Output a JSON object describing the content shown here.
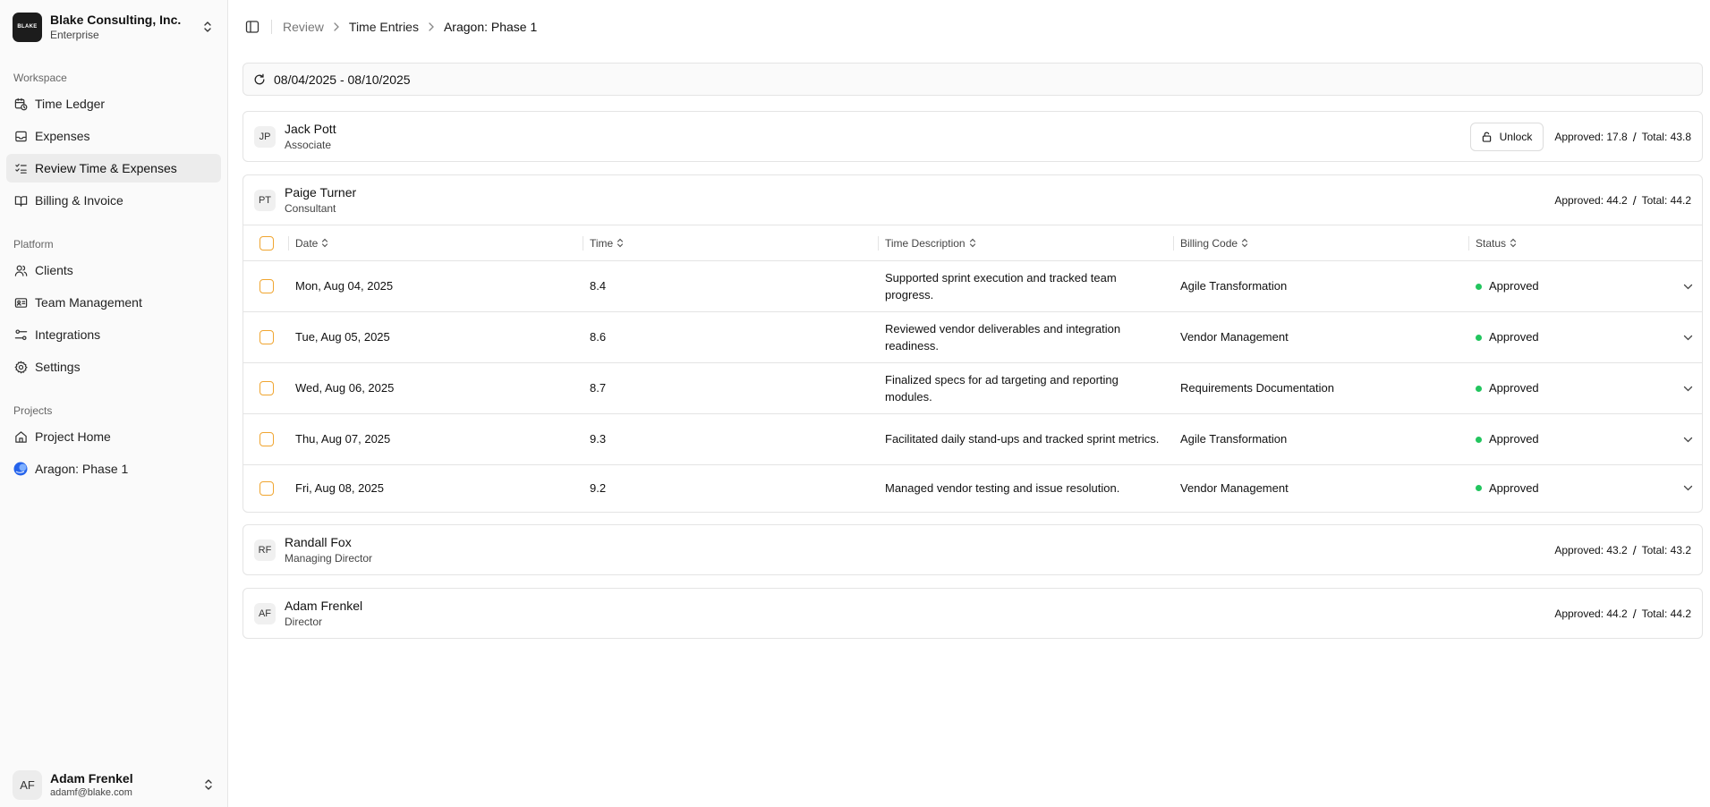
{
  "org": {
    "logo_text": "BLAKE",
    "name": "Blake Consulting, Inc.",
    "plan": "Enterprise"
  },
  "sidebar": {
    "workspace_title": "Workspace",
    "workspace": [
      {
        "label": "Time Ledger",
        "icon": "clock-calendar-icon"
      },
      {
        "label": "Expenses",
        "icon": "inbox-icon"
      },
      {
        "label": "Review Time & Expenses",
        "icon": "list-check-icon",
        "active": true
      },
      {
        "label": "Billing & Invoice",
        "icon": "book-icon"
      }
    ],
    "platform_title": "Platform",
    "platform": [
      {
        "label": "Clients",
        "icon": "users-icon"
      },
      {
        "label": "Team Management",
        "icon": "id-card-icon"
      },
      {
        "label": "Integrations",
        "icon": "sliders-icon"
      },
      {
        "label": "Settings",
        "icon": "gear-icon"
      }
    ],
    "projects_title": "Projects",
    "projects": [
      {
        "label": "Project Home",
        "icon": "home-icon"
      },
      {
        "label": "Aragon: Phase 1",
        "icon": "project-logo-icon"
      }
    ]
  },
  "user": {
    "initials": "AF",
    "name": "Adam Frenkel",
    "email": "adamf@blake.com"
  },
  "breadcrumb": {
    "item1": "Review",
    "item2": "Time Entries",
    "current": "Aragon: Phase 1"
  },
  "date_range": "08/04/2025 - 08/10/2025",
  "people": [
    {
      "initials": "JP",
      "name": "Jack Pott",
      "role": "Associate",
      "approved": "Approved: 17.8",
      "total": "Total: 43.8",
      "unlock_label": "Unlock"
    },
    {
      "initials": "PT",
      "name": "Paige Turner",
      "role": "Consultant",
      "approved": "Approved: 44.2",
      "total": "Total: 44.2"
    },
    {
      "initials": "RF",
      "name": "Randall Fox",
      "role": "Managing Director",
      "approved": "Approved: 43.2",
      "total": "Total: 43.2"
    },
    {
      "initials": "AF",
      "name": "Adam Frenkel",
      "role": "Director",
      "approved": "Approved: 44.2",
      "total": "Total: 44.2"
    }
  ],
  "table": {
    "columns": [
      "Date",
      "Time",
      "Time Description",
      "Billing Code",
      "Status"
    ],
    "rows": [
      {
        "date": "Mon, Aug 04, 2025",
        "time": "8.4",
        "desc": "Supported sprint execution and tracked team progress.",
        "code": "Agile Transformation",
        "status": "Approved"
      },
      {
        "date": "Tue, Aug 05, 2025",
        "time": "8.6",
        "desc": "Reviewed vendor deliverables and integration readiness.",
        "code": "Vendor Management",
        "status": "Approved"
      },
      {
        "date": "Wed, Aug 06, 2025",
        "time": "8.7",
        "desc": "Finalized specs for ad targeting and reporting modules.",
        "code": "Requirements Documentation",
        "status": "Approved"
      },
      {
        "date": "Thu, Aug 07, 2025",
        "time": "9.3",
        "desc": "Facilitated daily stand-ups and tracked sprint metrics.",
        "code": "Agile Transformation",
        "status": "Approved"
      },
      {
        "date": "Fri, Aug 08, 2025",
        "time": "9.2",
        "desc": "Managed vendor testing and issue resolution.",
        "code": "Vendor Management",
        "status": "Approved"
      }
    ]
  },
  "colors": {
    "approved_dot": "#22c55e",
    "checkbox_border": "#f0a530",
    "active_nav_bg": "#ececec"
  }
}
